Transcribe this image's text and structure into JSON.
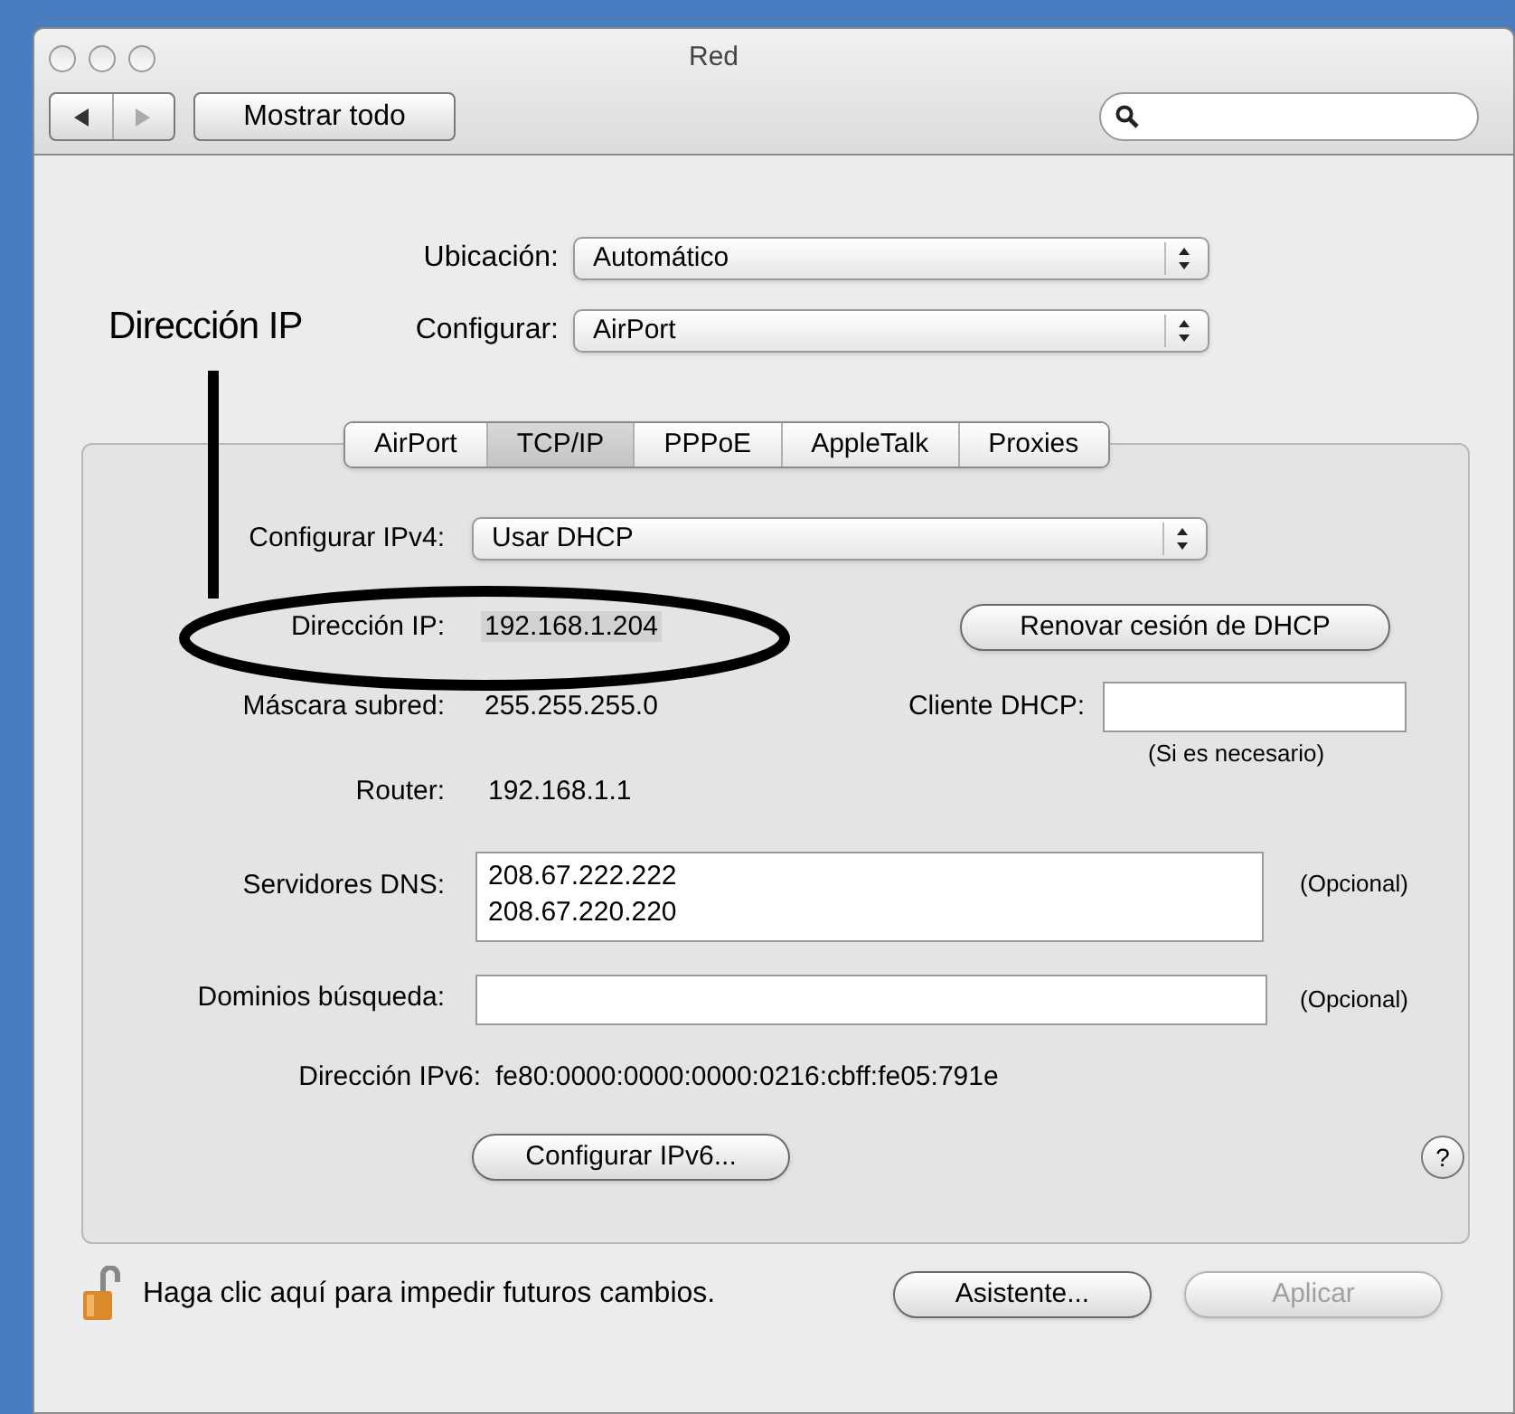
{
  "window": {
    "title": "Red"
  },
  "toolbar": {
    "show_all": "Mostrar todo"
  },
  "location": {
    "label": "Ubicación:",
    "value": "Automático"
  },
  "configure": {
    "label": "Configurar:",
    "value": "AirPort"
  },
  "tabs": [
    {
      "label": "AirPort",
      "selected": false
    },
    {
      "label": "TCP/IP",
      "selected": true
    },
    {
      "label": "PPPoE",
      "selected": false
    },
    {
      "label": "AppleTalk",
      "selected": false
    },
    {
      "label": "Proxies",
      "selected": false
    }
  ],
  "tcpip": {
    "configure_ipv4": {
      "label": "Configurar IPv4:",
      "value": "Usar DHCP"
    },
    "ip_address": {
      "label": "Dirección IP:",
      "value": "192.168.1.204"
    },
    "renew_button": "Renovar cesión de DHCP",
    "subnet_mask": {
      "label": "Máscara subred:",
      "value": "255.255.255.0"
    },
    "dhcp_client": {
      "label": "Cliente DHCP:",
      "hint": "(Si es necesario)"
    },
    "router": {
      "label": "Router:",
      "value": "192.168.1.1"
    },
    "dns": {
      "label": "Servidores DNS:",
      "values": [
        "208.67.222.222",
        "208.67.220.220"
      ],
      "note": "(Opcional)"
    },
    "search_domains": {
      "label": "Dominios búsqueda:",
      "note": "(Opcional)"
    },
    "ipv6_address": {
      "label": "Dirección IPv6:",
      "value": "fe80:0000:0000:0000:0216:cbff:fe05:791e"
    },
    "configure_ipv6_button": "Configurar IPv6...",
    "help": "?"
  },
  "footer": {
    "lock_text": "Haga clic aquí para impedir futuros cambios.",
    "buttons": [
      {
        "label": "Asistente...",
        "disabled": false
      },
      {
        "label": "Aplicar",
        "disabled": true
      }
    ]
  },
  "annotation": {
    "label": "Dirección IP"
  }
}
